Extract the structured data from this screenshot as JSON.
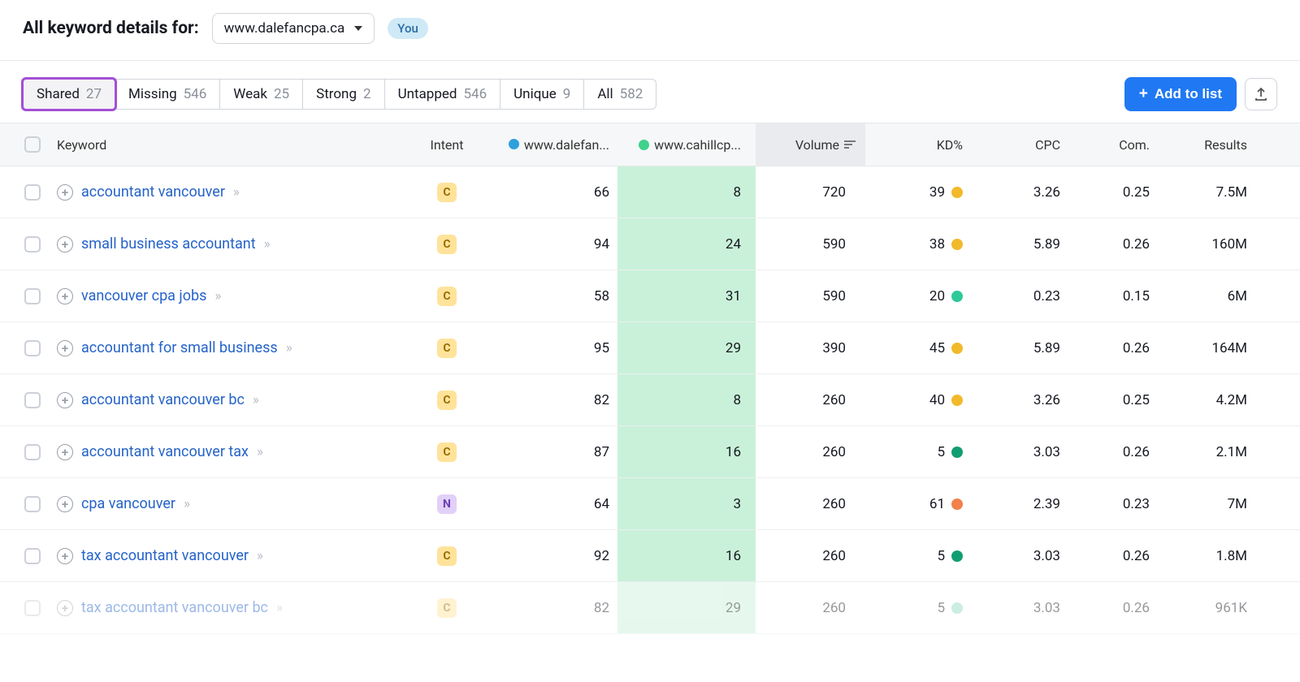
{
  "header": {
    "title": "All keyword details for:",
    "domain": "www.dalefancpa.ca",
    "you_badge": "You"
  },
  "tabs": [
    {
      "label": "Shared",
      "count": "27",
      "active": true
    },
    {
      "label": "Missing",
      "count": "546"
    },
    {
      "label": "Weak",
      "count": "25"
    },
    {
      "label": "Strong",
      "count": "2"
    },
    {
      "label": "Untapped",
      "count": "546"
    },
    {
      "label": "Unique",
      "count": "9"
    },
    {
      "label": "All",
      "count": "582"
    }
  ],
  "actions": {
    "add_to_list": "Add to list"
  },
  "columns": {
    "keyword": "Keyword",
    "intent": "Intent",
    "comp1": "www.dalefan...",
    "comp2": "www.cahillcp...",
    "volume": "Volume",
    "kd": "KD%",
    "cpc": "CPC",
    "com": "Com.",
    "results": "Results",
    "comp1_color": "#2ea0de",
    "comp2_color": "#3fd28b"
  },
  "rows": [
    {
      "keyword": "accountant vancouver",
      "intent": "C",
      "r1": "66",
      "r2": "8",
      "volume": "720",
      "kd": "39",
      "kd_color": "#f2b92b",
      "cpc": "3.26",
      "com": "0.25",
      "results": "7.5M"
    },
    {
      "keyword": "small business accountant",
      "intent": "C",
      "r1": "94",
      "r2": "24",
      "volume": "590",
      "kd": "38",
      "kd_color": "#f2b92b",
      "cpc": "5.89",
      "com": "0.26",
      "results": "160M"
    },
    {
      "keyword": "vancouver cpa jobs",
      "intent": "C",
      "r1": "58",
      "r2": "31",
      "volume": "590",
      "kd": "20",
      "kd_color": "#2ec998",
      "cpc": "0.23",
      "com": "0.15",
      "results": "6M"
    },
    {
      "keyword": "accountant for small business",
      "intent": "C",
      "r1": "95",
      "r2": "29",
      "volume": "390",
      "kd": "45",
      "kd_color": "#f2b92b",
      "cpc": "5.89",
      "com": "0.26",
      "results": "164M"
    },
    {
      "keyword": "accountant vancouver bc",
      "intent": "C",
      "r1": "82",
      "r2": "8",
      "volume": "260",
      "kd": "40",
      "kd_color": "#f2b92b",
      "cpc": "3.26",
      "com": "0.25",
      "results": "4.2M"
    },
    {
      "keyword": "accountant vancouver tax",
      "intent": "C",
      "r1": "87",
      "r2": "16",
      "volume": "260",
      "kd": "5",
      "kd_color": "#0f9e72",
      "cpc": "3.03",
      "com": "0.26",
      "results": "2.1M"
    },
    {
      "keyword": "cpa vancouver",
      "intent": "N",
      "r1": "64",
      "r2": "3",
      "volume": "260",
      "kd": "61",
      "kd_color": "#f1804a",
      "cpc": "2.39",
      "com": "0.23",
      "results": "7M"
    },
    {
      "keyword": "tax accountant vancouver",
      "intent": "C",
      "r1": "92",
      "r2": "16",
      "volume": "260",
      "kd": "5",
      "kd_color": "#0f9e72",
      "cpc": "3.03",
      "com": "0.26",
      "results": "1.8M"
    },
    {
      "keyword": "tax accountant vancouver bc",
      "intent": "C",
      "r1": "82",
      "r2": "29",
      "volume": "260",
      "kd": "5",
      "kd_color": "#8fd9c4",
      "cpc": "3.03",
      "com": "0.26",
      "results": "961K"
    }
  ]
}
